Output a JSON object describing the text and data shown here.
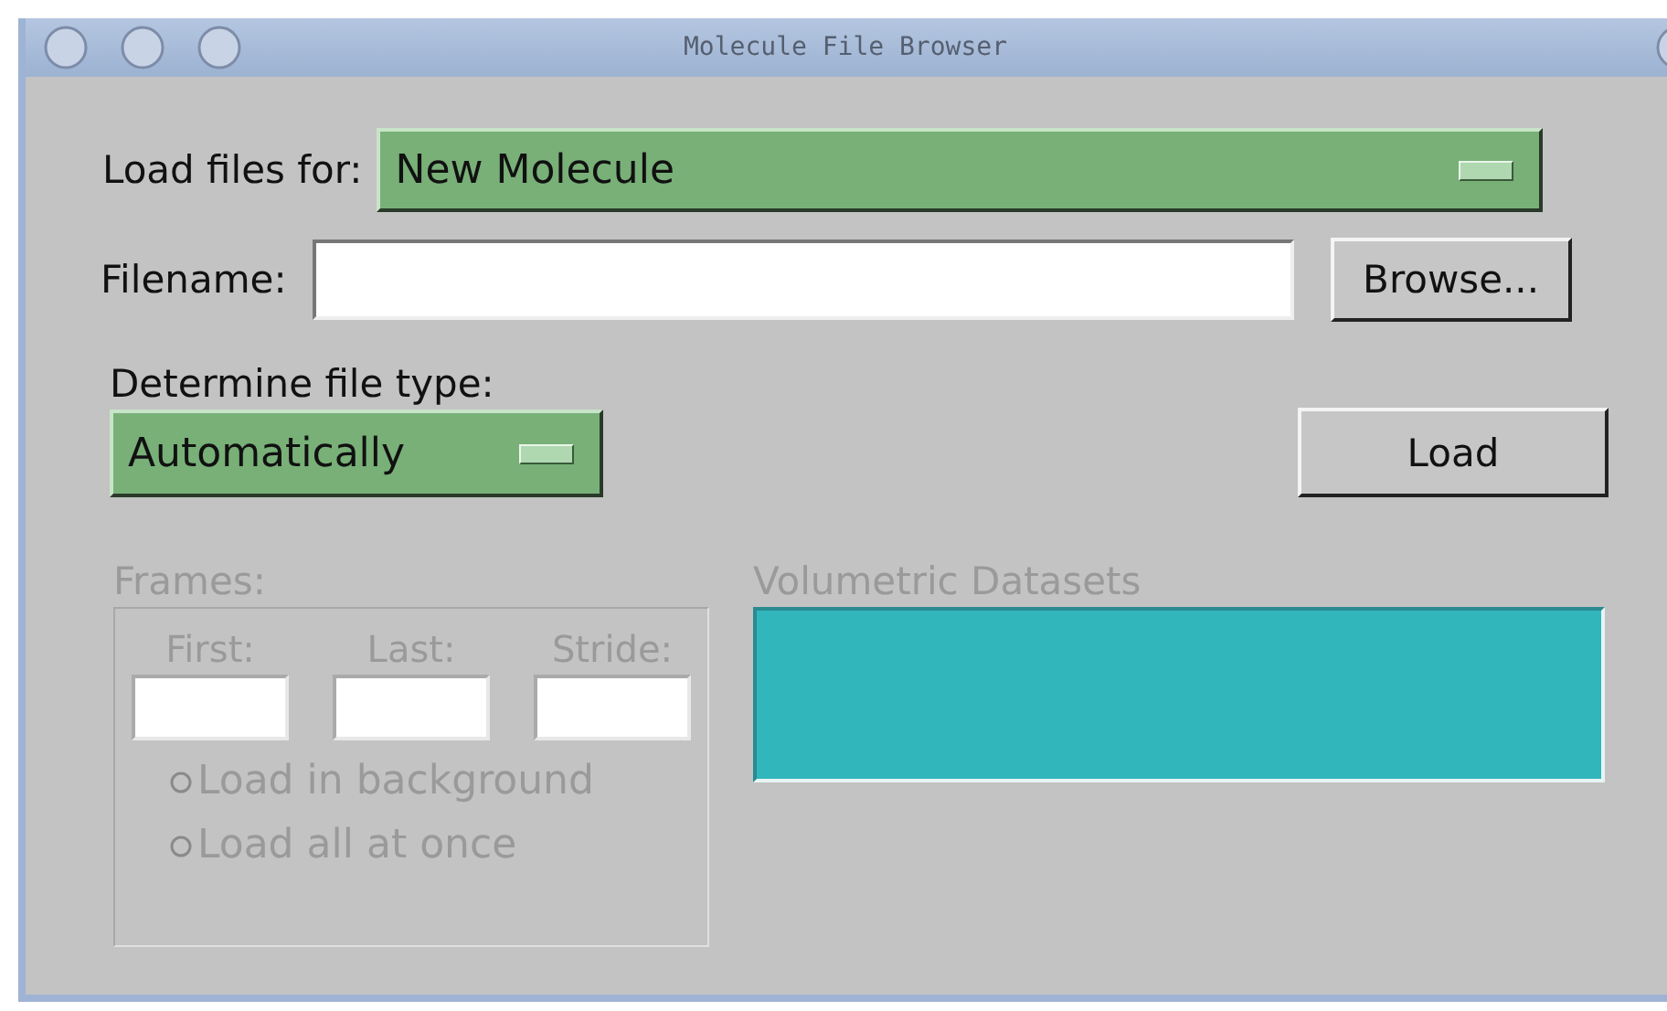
{
  "window": {
    "title": "Molecule File Browser"
  },
  "load_for": {
    "label": "Load files for:",
    "value": "New Molecule"
  },
  "filename": {
    "label": "Filename:",
    "button": "Browse..."
  },
  "file_type": {
    "label": "Determine file type:",
    "value": "Automatically"
  },
  "load_button": "Load",
  "frames": {
    "label": "Frames:",
    "disabled": true,
    "fields": [
      {
        "label": "First:"
      },
      {
        "label": "Last:"
      },
      {
        "label": "Stride:"
      }
    ],
    "options": [
      {
        "label": "Load in background",
        "selected": false
      },
      {
        "label": "Load all at once",
        "selected": false
      }
    ]
  },
  "volumetric": {
    "label": "Volumetric Datasets",
    "disabled": true
  }
}
